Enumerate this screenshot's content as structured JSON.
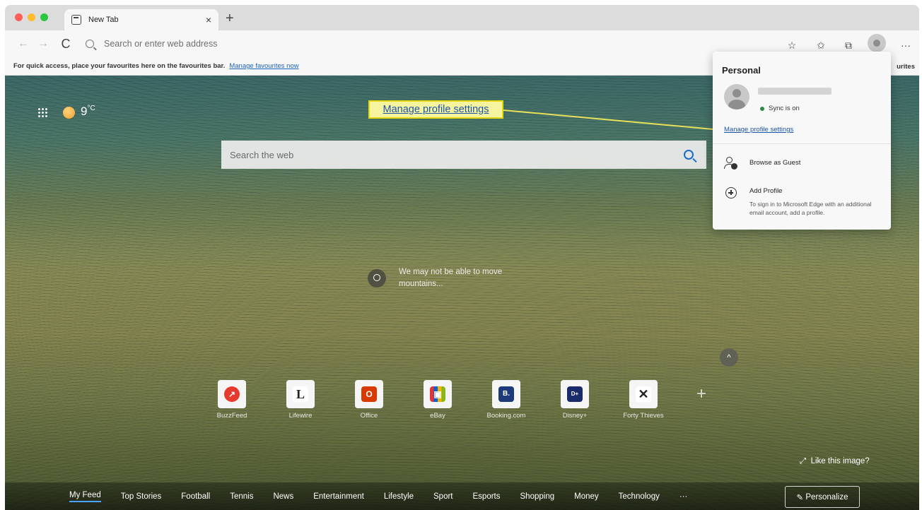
{
  "tab": {
    "title": "New Tab",
    "close": "×",
    "new_tab": "+"
  },
  "toolbar": {
    "back": "←",
    "forward": "→",
    "reload": "C",
    "address_placeholder": "Search or enter web address",
    "more": "···"
  },
  "favbar": {
    "text": "For quick access, place your favourites here on the favourites bar.",
    "link": "Manage favourites now",
    "right_text": "urites"
  },
  "weather": {
    "temp": "9",
    "unit": "°C"
  },
  "callout": {
    "label": "Manage profile settings"
  },
  "search": {
    "placeholder": "Search the web"
  },
  "caption": {
    "text": "We may not be able to move mountains..."
  },
  "tiles": [
    {
      "label": "BuzzFeed",
      "glyph": "↗",
      "color": "#e63a2e"
    },
    {
      "label": "Lifewire",
      "glyph": "L",
      "color": "#ffffff"
    },
    {
      "label": "Office",
      "glyph": "O",
      "color": "#d83b01"
    },
    {
      "label": "eBay",
      "glyph": "▣",
      "color": "#1b4e9e"
    },
    {
      "label": "Booking.com",
      "glyph": "B.",
      "color": "#1e3a7b"
    },
    {
      "label": "Disney+",
      "glyph": "D+",
      "color": "#1a2b6b"
    },
    {
      "label": "Forty Thieves",
      "glyph": "✕",
      "color": "#ffffff"
    }
  ],
  "add_tile": "+",
  "collapse": "^",
  "like_image": "Like this image?",
  "feed": {
    "items": [
      "My Feed",
      "Top Stories",
      "Football",
      "Tennis",
      "News",
      "Entertainment",
      "Lifestyle",
      "Sport",
      "Esports",
      "Shopping",
      "Money",
      "Technology",
      "···"
    ],
    "personalize": "Personalize"
  },
  "profile_panel": {
    "title": "Personal",
    "sync": "Sync is on",
    "manage_link": "Manage profile settings",
    "guest": "Browse as Guest",
    "add_profile": "Add Profile",
    "add_profile_desc": "To sign in to Microsoft Edge with an additional email account, add a profile."
  }
}
